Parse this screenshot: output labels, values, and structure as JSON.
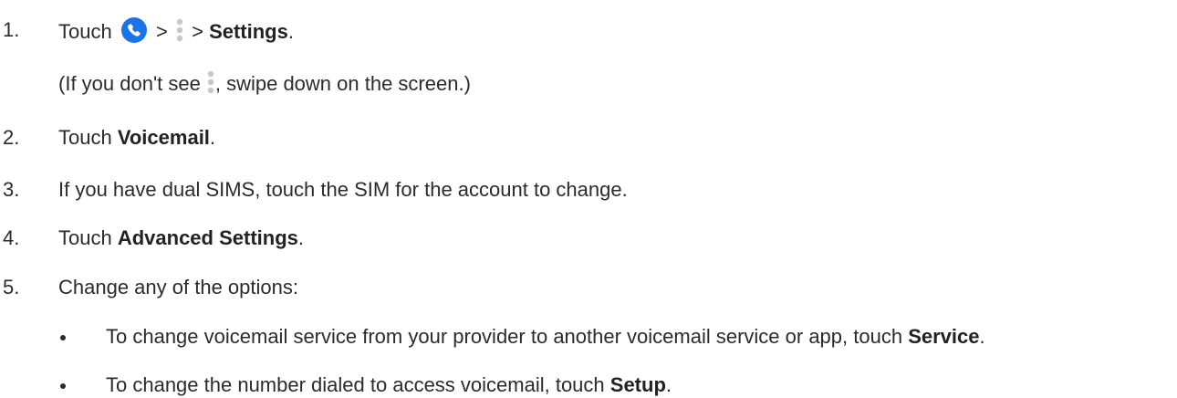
{
  "steps": [
    {
      "number": "1.",
      "pre": "Touch",
      "sep1": ">",
      "sep2": ">",
      "bold": "Settings",
      "end": ".",
      "note_pre": "(If you don't see",
      "note_post": ", swipe down on the screen.)"
    },
    {
      "number": "2.",
      "pre": "Touch ",
      "bold": "Voicemail",
      "end": "."
    },
    {
      "number": "3.",
      "text": "If you have dual SIMS, touch the SIM for the account to change."
    },
    {
      "number": "4.",
      "pre": "Touch ",
      "bold": "Advanced Settings",
      "end": "."
    },
    {
      "number": "5.",
      "text": "Change any of the options:"
    }
  ],
  "bullets": [
    {
      "pre": "To change voicemail service from your provider to another voicemail service or app, touch ",
      "bold": "Service",
      "end": "."
    },
    {
      "pre": "To change the number dialed to access voicemail, touch ",
      "bold": "Setup",
      "end": "."
    }
  ],
  "icons": {
    "phone": "phone-app-icon",
    "more": "more-vert-icon",
    "phone_color": "#1a73e8",
    "dots_color": "#c8c8c8"
  }
}
